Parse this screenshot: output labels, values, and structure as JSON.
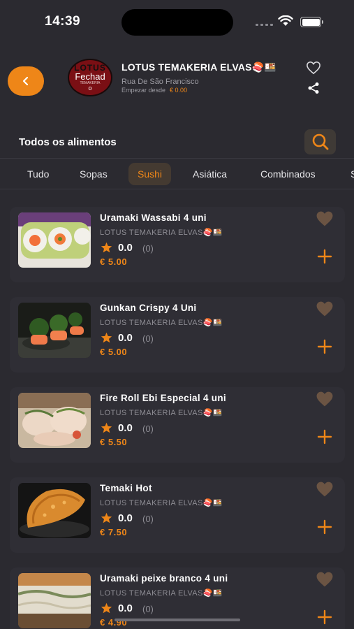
{
  "status_bar": {
    "time": "14:39"
  },
  "restaurant": {
    "logo_line1": "LOTUS",
    "logo_line2": "Fechad",
    "logo_line3": "TEMAKERIA",
    "logo_line4": "o",
    "name": "LOTUS TEMAKERIA ELVAS🍣🍱",
    "address": "Rua De São Francisco",
    "min_label": "Empezar desde",
    "min_value": "€ 0.00"
  },
  "section_title": "Todos os alimentos",
  "tabs": [
    {
      "label": "Tudo",
      "active": false
    },
    {
      "label": "Sopas",
      "active": false
    },
    {
      "label": "Sushi",
      "active": true
    },
    {
      "label": "Asiática",
      "active": false
    },
    {
      "label": "Combinados",
      "active": false
    },
    {
      "label": "S",
      "active": false
    }
  ],
  "items": [
    {
      "name": "Uramaki Wassabi 4 uni",
      "restaurant": "LOTUS TEMAKERIA ELVAS🍣🍱",
      "rating": "0.0",
      "rating_count": "(0)",
      "price": "€ 5.00"
    },
    {
      "name": "Gunkan Crispy 4 Uni",
      "restaurant": "LOTUS TEMAKERIA ELVAS🍣🍱",
      "rating": "0.0",
      "rating_count": "(0)",
      "price": "€ 5.00"
    },
    {
      "name": "Fire Roll Ebi Especial 4 uni",
      "restaurant": "LOTUS TEMAKERIA ELVAS🍣🍱",
      "rating": "0.0",
      "rating_count": "(0)",
      "price": "€ 5.50"
    },
    {
      "name": "Temaki Hot",
      "restaurant": "LOTUS TEMAKERIA ELVAS🍣🍱",
      "rating": "0.0",
      "rating_count": "(0)",
      "price": "€ 7.50"
    },
    {
      "name": "Uramaki peixe branco 4 uni",
      "restaurant": "LOTUS TEMAKERIA ELVAS🍣🍱",
      "rating": "0.0",
      "rating_count": "(0)",
      "price": "€ 4.90"
    }
  ],
  "colors": {
    "accent": "#ee8618",
    "background": "#2b2a30",
    "card": "#2f2e35",
    "heart": "#6b5443"
  }
}
